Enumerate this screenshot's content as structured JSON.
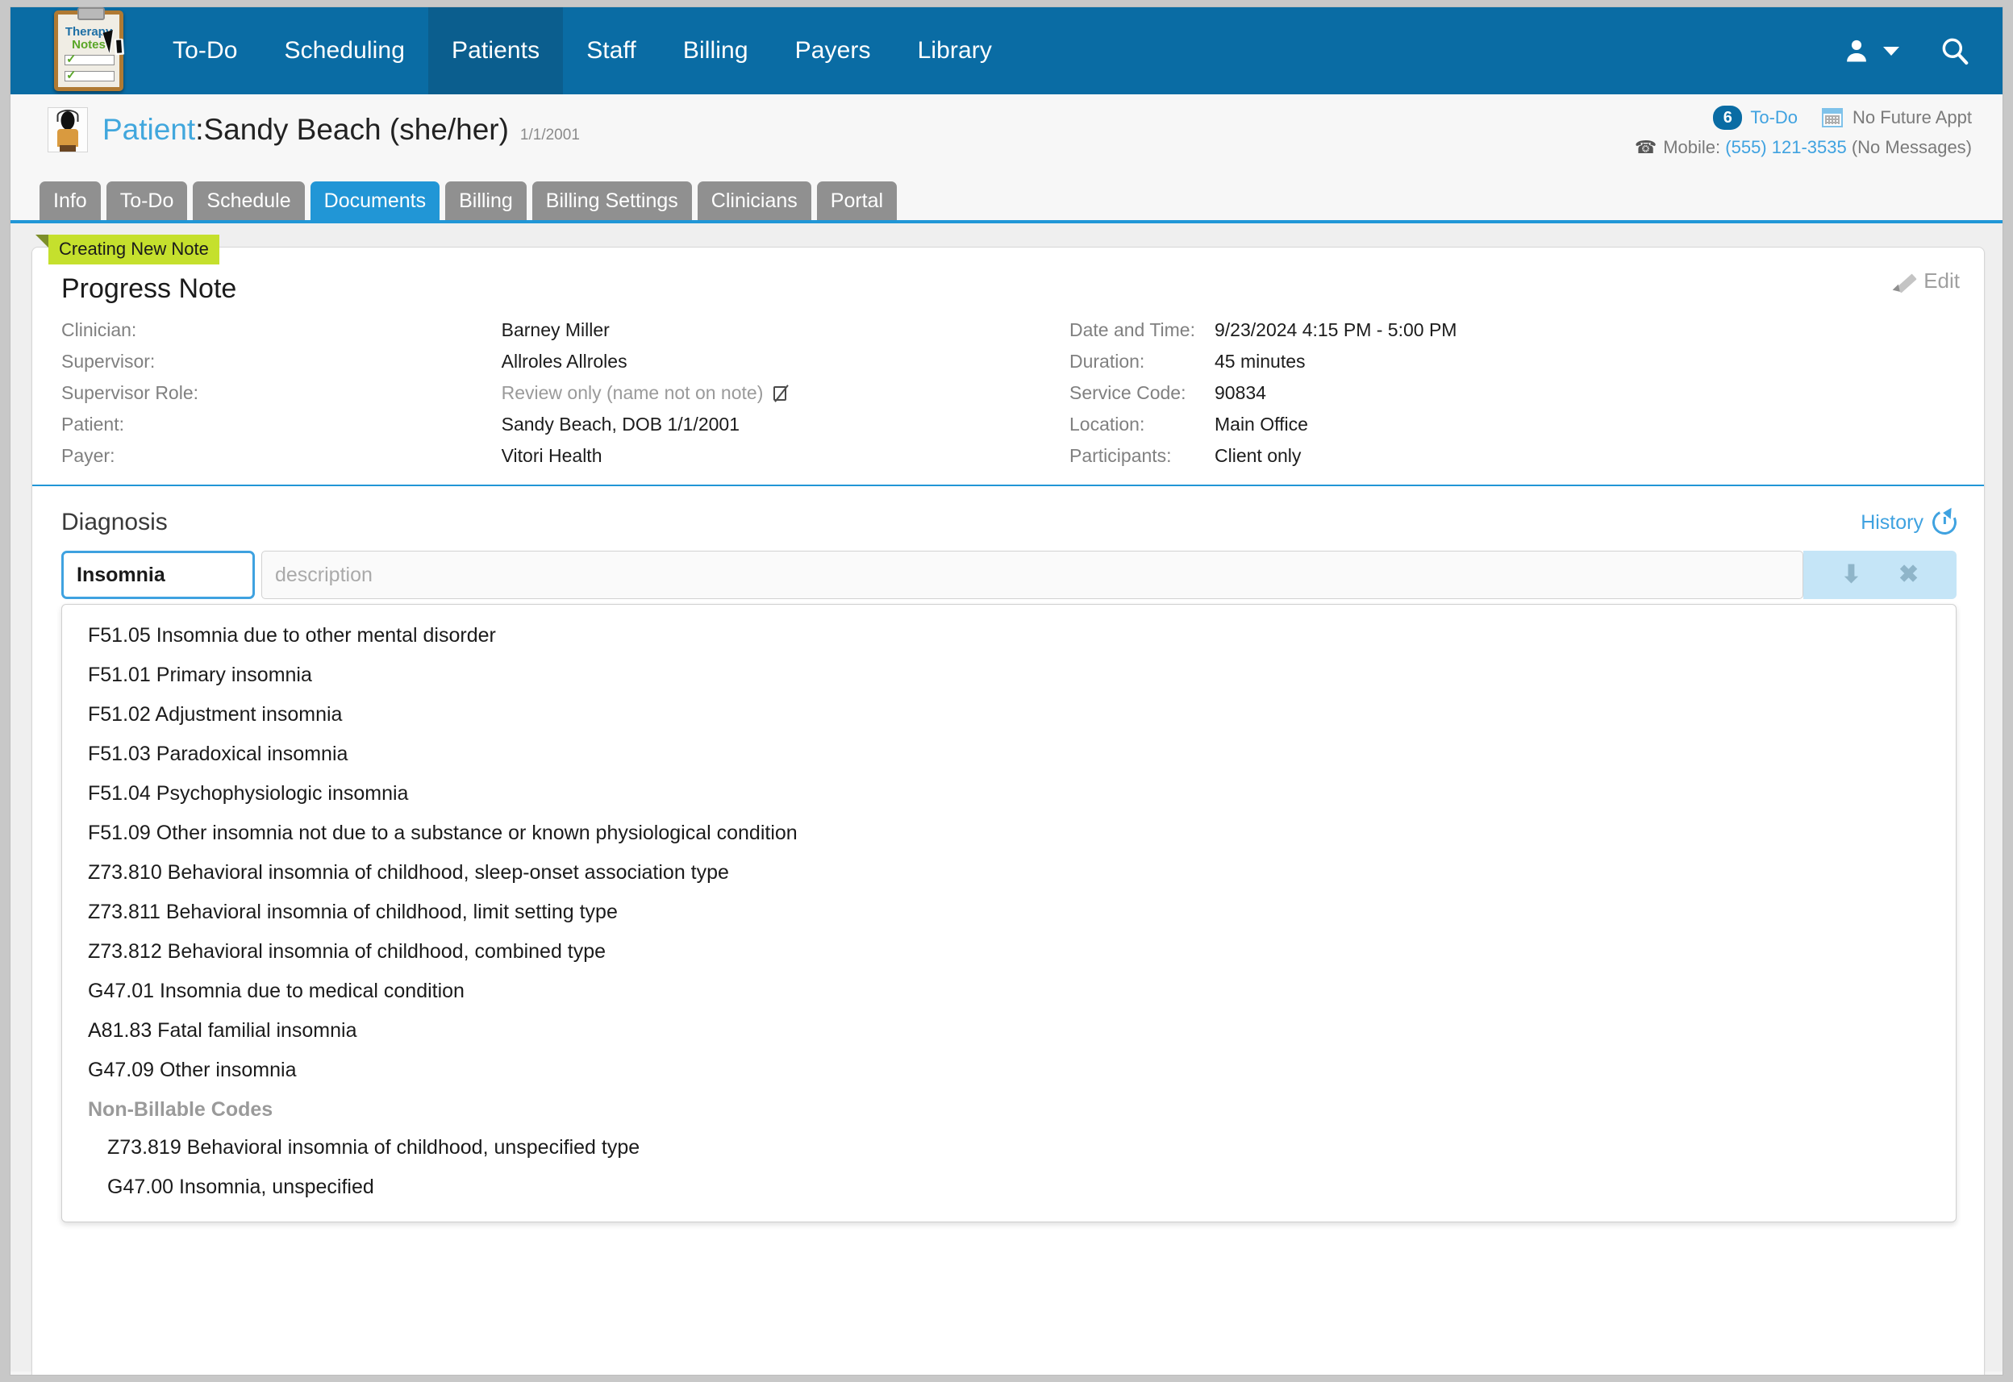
{
  "app": {
    "logo": {
      "line1": "Therapy",
      "line2": "Notes",
      "name": "therapynotes-logo"
    },
    "nav_items": [
      {
        "label": "To-Do",
        "active": false
      },
      {
        "label": "Scheduling",
        "active": false
      },
      {
        "label": "Patients",
        "active": true
      },
      {
        "label": "Staff",
        "active": false
      },
      {
        "label": "Billing",
        "active": false
      },
      {
        "label": "Payers",
        "active": false
      },
      {
        "label": "Library",
        "active": false
      }
    ],
    "nav_right": [
      {
        "name": "user-account-icon"
      },
      {
        "name": "chevron-down-icon"
      },
      {
        "name": "search-icon"
      }
    ],
    "accent_color": "#0a6ca4",
    "tab_active_color": "#2196d6"
  },
  "patient_header": {
    "label": "Patient",
    "separator": ": ",
    "name": "Sandy Beach (she/her)",
    "dob": "1/1/2001",
    "todo_count": "6",
    "todo_label": "To-Do",
    "future_appt": "No Future Appt",
    "phone_label": "Mobile:",
    "phone_number": "(555) 121-3535",
    "messages_note": "(No Messages)"
  },
  "tabs": [
    {
      "label": "Info",
      "active": false
    },
    {
      "label": "To-Do",
      "active": false
    },
    {
      "label": "Schedule",
      "active": false
    },
    {
      "label": "Documents",
      "active": true
    },
    {
      "label": "Billing",
      "active": false
    },
    {
      "label": "Billing Settings",
      "active": false
    },
    {
      "label": "Clinicians",
      "active": false
    },
    {
      "label": "Portal",
      "active": false
    }
  ],
  "note": {
    "ribbon": "Creating New Note",
    "title": "Progress Note",
    "edit_label": "Edit",
    "left_details": [
      {
        "key": "Clinician:",
        "value": "Barney Miller",
        "muted": false
      },
      {
        "key": "Supervisor:",
        "value": "Allroles Allroles",
        "muted": false
      },
      {
        "key": "Supervisor Role:",
        "value": "Review only (name not on note)",
        "muted": true,
        "icon": "name-not-on-note-icon"
      },
      {
        "key": "Patient:",
        "value": "Sandy Beach, DOB 1/1/2001",
        "muted": false
      },
      {
        "key": "Payer:",
        "value": "Vitori Health",
        "muted": false
      }
    ],
    "right_details": [
      {
        "key": "Date and Time:",
        "value": "9/23/2024 4:15 PM - 5:00 PM",
        "muted": false
      },
      {
        "key": "Duration:",
        "value": "45 minutes",
        "muted": false
      },
      {
        "key": "Service Code:",
        "value": "90834",
        "muted": false
      },
      {
        "key": "Location:",
        "value": "Main Office",
        "muted": false
      },
      {
        "key": "Participants:",
        "value": "Client only",
        "muted": false
      }
    ]
  },
  "diagnosis": {
    "title": "Diagnosis",
    "history_label": "History",
    "code_value": "Insomnia",
    "description_placeholder": "description",
    "row_actions": [
      {
        "name": "move-down-icon",
        "glyph": "⬇"
      },
      {
        "name": "remove-row-icon",
        "glyph": "✖"
      }
    ],
    "suggestions": [
      {
        "text": "F51.05 Insomnia due to other mental disorder",
        "type": "item"
      },
      {
        "text": "F51.01 Primary insomnia",
        "type": "item"
      },
      {
        "text": "F51.02 Adjustment insomnia",
        "type": "item"
      },
      {
        "text": "F51.03 Paradoxical insomnia",
        "type": "item"
      },
      {
        "text": "F51.04 Psychophysiologic insomnia",
        "type": "item"
      },
      {
        "text": "F51.09 Other insomnia not due to a substance or known physiological condition",
        "type": "item"
      },
      {
        "text": "Z73.810 Behavioral insomnia of childhood, sleep-onset association type",
        "type": "item"
      },
      {
        "text": "Z73.811 Behavioral insomnia of childhood, limit setting type",
        "type": "item"
      },
      {
        "text": "Z73.812 Behavioral insomnia of childhood, combined type",
        "type": "item"
      },
      {
        "text": "G47.01 Insomnia due to medical condition",
        "type": "item"
      },
      {
        "text": "A81.83 Fatal familial insomnia",
        "type": "item"
      },
      {
        "text": "G47.09 Other insomnia",
        "type": "item"
      },
      {
        "text": "Non-Billable Codes",
        "type": "group"
      },
      {
        "text": "Z73.819 Behavioral insomnia of childhood, unspecified type",
        "type": "sub"
      },
      {
        "text": "G47.00 Insomnia, unspecified",
        "type": "sub"
      }
    ]
  }
}
